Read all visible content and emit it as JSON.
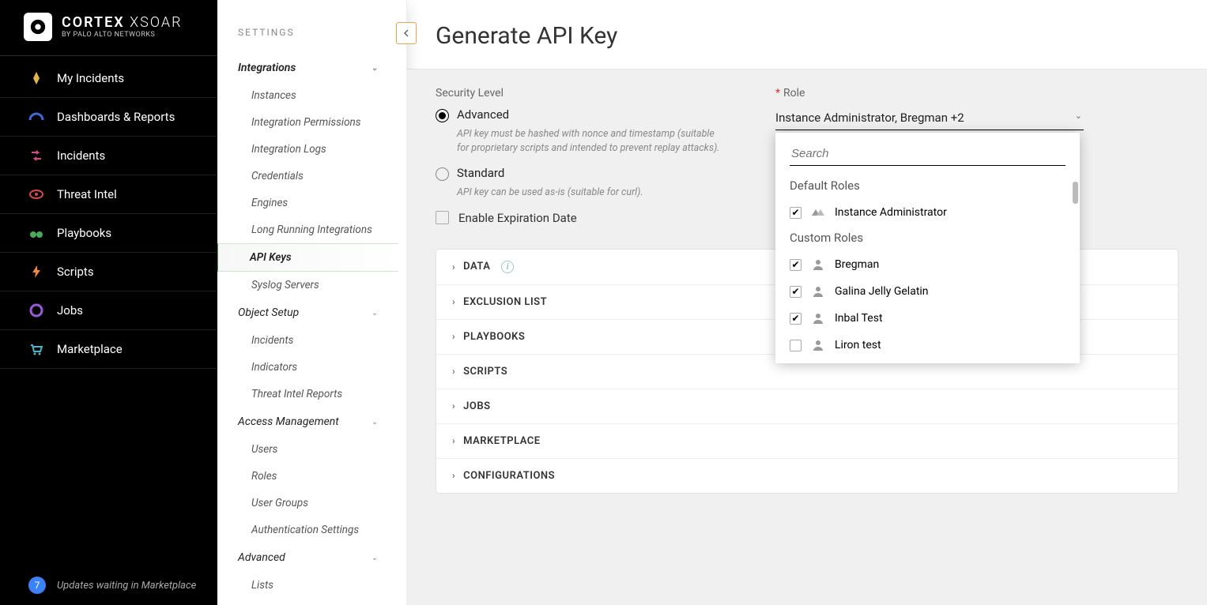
{
  "brand": {
    "name": "CORTEX",
    "product": "XSOAR",
    "byline": "BY PALO ALTO NETWORKS"
  },
  "mainnav": [
    {
      "label": "My Incidents",
      "icon": "fire"
    },
    {
      "label": "Dashboards & Reports",
      "icon": "gauge"
    },
    {
      "label": "Incidents",
      "icon": "arrows"
    },
    {
      "label": "Threat Intel",
      "icon": "eye"
    },
    {
      "label": "Playbooks",
      "icon": "binoc"
    },
    {
      "label": "Scripts",
      "icon": "bolt"
    },
    {
      "label": "Jobs",
      "icon": "circle"
    },
    {
      "label": "Marketplace",
      "icon": "cart"
    }
  ],
  "updates": {
    "count": "7",
    "label": "Updates waiting in Marketplace"
  },
  "settings": {
    "heading": "SETTINGS",
    "groups": [
      {
        "label": "Integrations",
        "bold": true,
        "children": [
          "Instances",
          "Integration Permissions",
          "Integration Logs",
          "Credentials",
          "Engines",
          "Long Running Integrations",
          "API Keys",
          "Syslog Servers"
        ],
        "activeChild": "API Keys"
      },
      {
        "label": "Object Setup",
        "bold": false,
        "children": [
          "Incidents",
          "Indicators",
          "Threat Intel Reports"
        ],
        "activeChild": null
      },
      {
        "label": "Access Management",
        "bold": false,
        "children": [
          "Users",
          "Roles",
          "User Groups",
          "Authentication Settings"
        ],
        "activeChild": null
      },
      {
        "label": "Advanced",
        "bold": false,
        "children": [
          "Lists"
        ],
        "activeChild": null
      }
    ]
  },
  "page": {
    "title": "Generate API Key",
    "securityLevel": {
      "label": "Security Level",
      "advanced": {
        "label": "Advanced",
        "desc": "API key must be hashed with nonce and timestamp (suitable for proprietary scripts and intended to prevent replay attacks).",
        "checked": true
      },
      "standard": {
        "label": "Standard",
        "desc": "API key can be used as-is (suitable for curl).",
        "checked": false
      }
    },
    "enableExpiration": {
      "label": "Enable Expiration Date",
      "checked": false
    },
    "role": {
      "label": "Role",
      "display": "Instance Administrator, Bregman +2",
      "searchPlaceholder": "Search",
      "defaultSection": "Default Roles",
      "customSection": "Custom Roles",
      "default": [
        {
          "label": "Instance Administrator",
          "checked": true
        }
      ],
      "custom": [
        {
          "label": "Bregman",
          "checked": true
        },
        {
          "label": "Galina Jelly Gelatin",
          "checked": true
        },
        {
          "label": "Inbal Test",
          "checked": true
        },
        {
          "label": "Liron test",
          "checked": false
        }
      ]
    },
    "accordion": [
      {
        "label": "DATA",
        "info": true
      },
      {
        "label": "EXCLUSION LIST",
        "info": false
      },
      {
        "label": "PLAYBOOKS",
        "info": false
      },
      {
        "label": "SCRIPTS",
        "info": false
      },
      {
        "label": "JOBS",
        "info": false
      },
      {
        "label": "MARKETPLACE",
        "info": false
      },
      {
        "label": "CONFIGURATIONS",
        "info": false
      }
    ]
  }
}
